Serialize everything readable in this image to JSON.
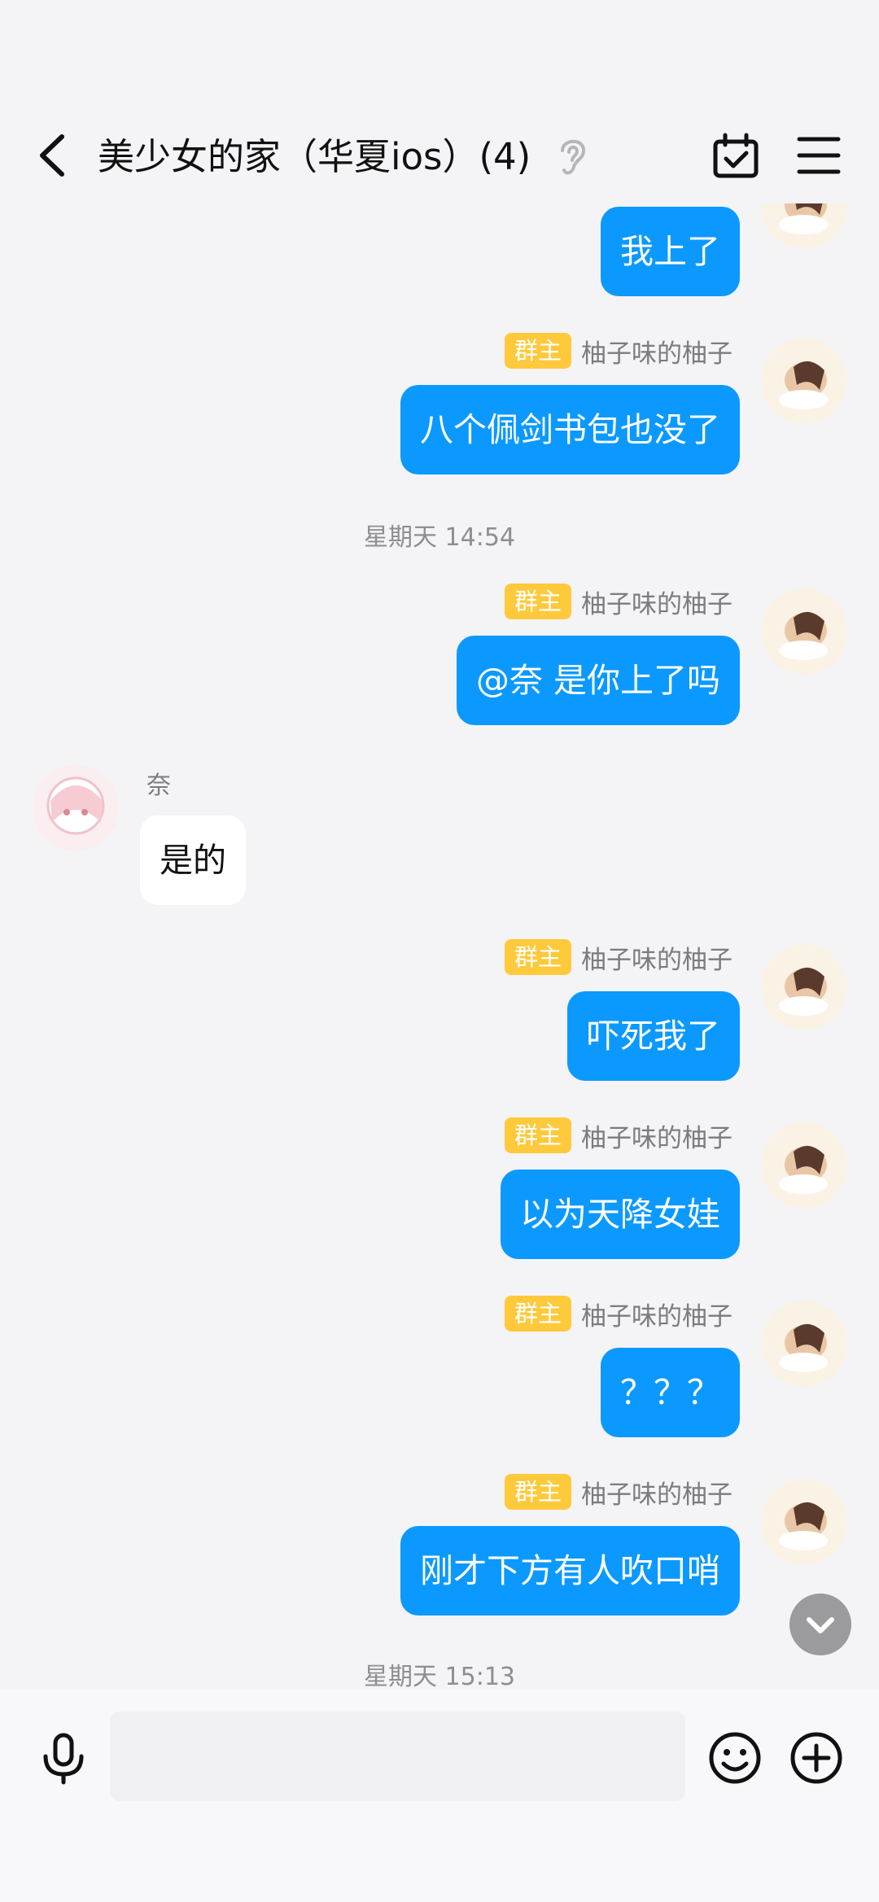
{
  "header": {
    "title": "美少女的家（华夏ios）(4)",
    "icons": [
      "back-icon",
      "ear-icon",
      "calendar-check-icon",
      "menu-icon"
    ]
  },
  "messages": [
    {
      "side": "right",
      "text": "我上了"
    },
    {
      "side": "right",
      "badge": "群主",
      "sender": "柚子味的柚子",
      "text": "八个佩剑书包也没了"
    },
    {
      "time": "星期天 14:54"
    },
    {
      "side": "right",
      "badge": "群主",
      "sender": "柚子味的柚子",
      "text": "@奈 是你上了吗"
    },
    {
      "side": "left",
      "sender": "奈",
      "text": "是的"
    },
    {
      "side": "right",
      "badge": "群主",
      "sender": "柚子味的柚子",
      "text": "吓死我了"
    },
    {
      "side": "right",
      "badge": "群主",
      "sender": "柚子味的柚子",
      "text": "以为天降女娃"
    },
    {
      "side": "right",
      "badge": "群主",
      "sender": "柚子味的柚子",
      "text": "？？？"
    },
    {
      "side": "right",
      "badge": "群主",
      "sender": "柚子味的柚子",
      "text": "刚才下方有人吹口哨"
    },
    {
      "time": "星期天 15:13"
    }
  ],
  "input": {
    "value": "",
    "placeholder": ""
  },
  "colors": {
    "bubble_self": "#0b99ff",
    "badge_owner": "#ffc93c",
    "background": "#f4f4f6"
  }
}
